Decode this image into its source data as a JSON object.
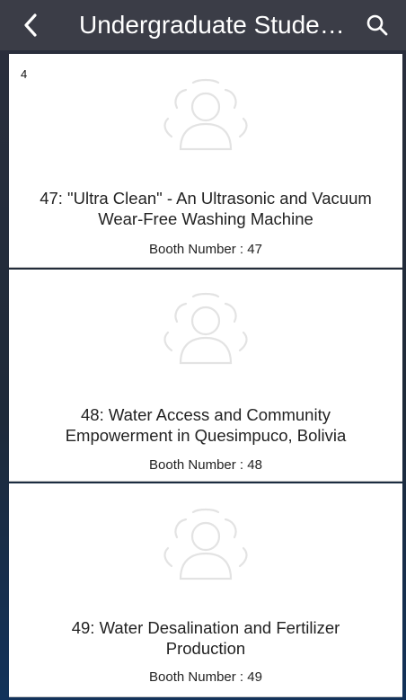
{
  "header": {
    "title": "Undergraduate Student…",
    "back_icon": "chevron-left-icon",
    "search_icon": "search-icon"
  },
  "colors": {
    "header_bg": "#3b3d47",
    "card_bg": "#ffffff",
    "text": "#222222",
    "icon_stroke": "#e3e3e3"
  },
  "cards": [
    {
      "badge": "4",
      "title_line1": "47: \"Ultra Clean\" - An Ultrasonic and Vacuum",
      "title_line2": "Wear-Free Washing Machine",
      "booth": "Booth Number : 47",
      "icon": "group-avatar-icon"
    },
    {
      "title_line1": "48: Water Access and Community",
      "title_line2": "Empowerment in Quesimpuco, Bolivia",
      "booth": "Booth Number : 48",
      "icon": "group-avatar-icon"
    },
    {
      "title_line1": "49: Water Desalination and Fertilizer",
      "title_line2": "Production",
      "booth": "Booth Number : 49",
      "icon": "group-avatar-icon"
    }
  ]
}
